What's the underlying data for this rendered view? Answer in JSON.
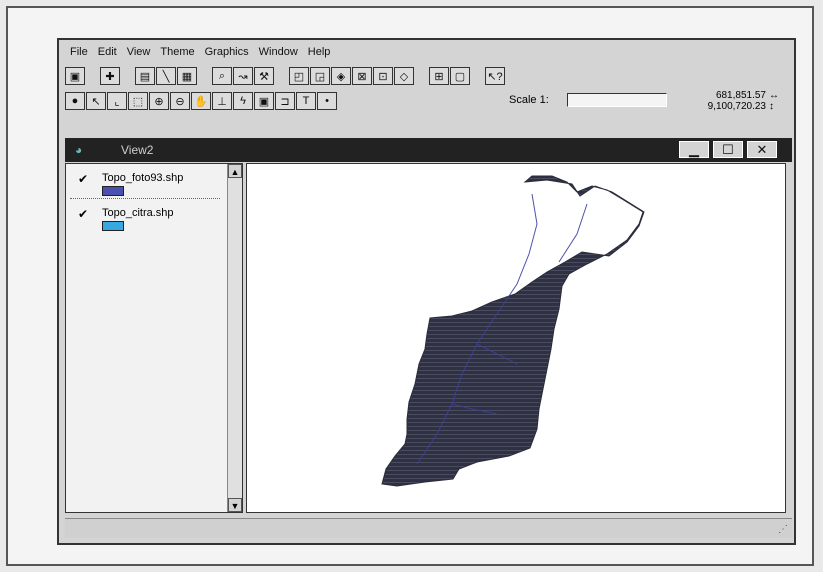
{
  "menu": [
    "File",
    "Edit",
    "View",
    "Theme",
    "Graphics",
    "Window",
    "Help"
  ],
  "toolbar1_icons": [
    "save-icon",
    "add-theme-icon",
    "theme-properties-icon",
    "edit-legend-icon",
    "table-icon",
    "find-icon",
    "locate-icon",
    "query-builder-icon",
    "zoom-full-icon",
    "zoom-active-icons-icon",
    "zoom-selected-icon",
    "zoom-in-fixed-icon",
    "zoom-out-fixed-icon",
    "zoom-previous-icon",
    "select-features-icon",
    "clear-selection-icon",
    "help-icon"
  ],
  "toolbar2_icons": [
    "identify-icon",
    "pointer-icon",
    "vertex-edit-icon",
    "select-feature-icon",
    "zoom-in-icon",
    "zoom-out-icon",
    "pan-icon",
    "measure-icon",
    "hotlink-icon",
    "area-of-interest-icon",
    "label-icon",
    "text-icon",
    "draw-point-icon"
  ],
  "scale": {
    "label": "Scale 1:",
    "value": ""
  },
  "coords": {
    "x": "681,851.57",
    "y": "9,100,720.23"
  },
  "view": {
    "title": "View2"
  },
  "toc": {
    "items": [
      {
        "name": "Topo_foto93.shp",
        "checked": true,
        "color": "#4a4fb0"
      },
      {
        "name": "Topo_citra.shp",
        "checked": true,
        "color": "#3aa8e0"
      }
    ]
  },
  "map": {
    "fill_color": "#2f3142",
    "accent_color": "#3b3fa0"
  }
}
